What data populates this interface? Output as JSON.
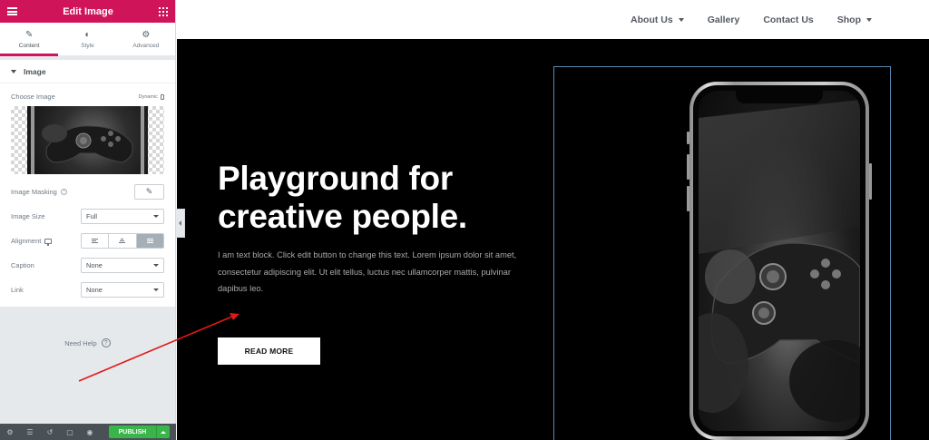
{
  "panel": {
    "header_title": "Edit Image",
    "tabs": [
      {
        "label": "Content",
        "icon": "pencil-icon",
        "active": true
      },
      {
        "label": "Style",
        "icon": "half-circle-icon",
        "active": false
      },
      {
        "label": "Advanced",
        "icon": "gear-icon",
        "active": false
      }
    ],
    "section_title": "Image",
    "choose_image_label": "Choose Image",
    "dynamic_label": "Dynamic",
    "image_masking_label": "Image Masking",
    "image_size_label": "Image Size",
    "image_size_value": "Full",
    "alignment_label": "Alignment",
    "caption_label": "Caption",
    "caption_value": "None",
    "link_label": "Link",
    "link_value": "None",
    "need_help_label": "Need Help",
    "publish_label": "PUBLISH",
    "accent_color": "#d0145a",
    "publish_color": "#39b54a"
  },
  "site": {
    "nav": [
      {
        "label": "About Us",
        "dropdown": true
      },
      {
        "label": "Gallery",
        "dropdown": false
      },
      {
        "label": "Contact Us",
        "dropdown": false
      },
      {
        "label": "Shop",
        "dropdown": true
      }
    ],
    "hero_title": "Playground for creative people.",
    "hero_text": "I am text block. Click edit button to change this text. Lorem ipsum dolor sit amet, consectetur adipiscing elit. Ut elit tellus, luctus nec ullamcorper mattis, pulvinar dapibus leo.",
    "button_label": "READ MORE"
  }
}
